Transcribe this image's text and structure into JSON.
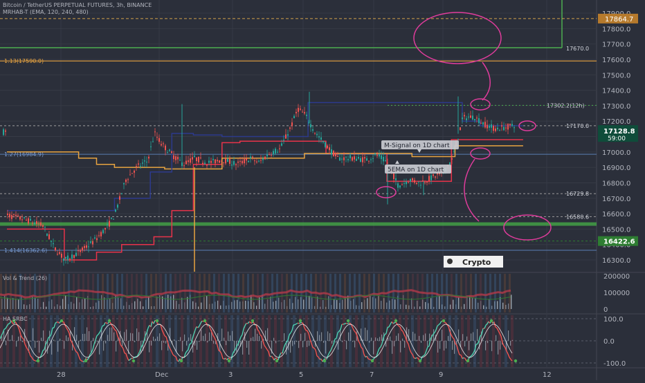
{
  "header": {
    "symbol_line": "Bitcoin / TetherUS PERPETUAL FUTURES, 3h, BINANCE",
    "indicator_line": "MRHAB-T (EMA, 120, 240, 480)"
  },
  "price_axis": {
    "ticks": [
      "17900.0",
      "17800.0",
      "17700.0",
      "17600.0",
      "17500.0",
      "17400.0",
      "17300.0",
      "17200.0",
      "17100.0",
      "17000.0",
      "16900.0",
      "16800.0",
      "16700.0",
      "16600.0",
      "16500.0",
      "16400.0",
      "16300.0"
    ],
    "highlight_top": "17864.7",
    "last_price": "17128.8",
    "countdown": "59:00",
    "highlight_bottom": "16422.6"
  },
  "levels": {
    "l17670": "17670.0",
    "fib113": "1.13(17590.0)",
    "l17302": "17302.2(12h)",
    "l17170": "17170.0",
    "fib127": "1.27(16984.9)",
    "l16729": "16729.8",
    "l16580": "16580.6",
    "fib1414": "1.414(16362.6)"
  },
  "annotations": {
    "msignal": "M-Signal on 1D chart",
    "ema5": "5EMA on 1D chart",
    "logo": "Crypto"
  },
  "vol_panel": {
    "title": "Vol & Trend (26)",
    "ticks": [
      "200000",
      "100000",
      "0"
    ]
  },
  "ha_panel": {
    "title": "HA SRBC",
    "ticks": [
      "100.0",
      "0.0",
      "-100.0"
    ]
  },
  "time_axis": {
    "labels": [
      "28",
      "Dec",
      "3",
      "5",
      "7",
      "9",
      "12"
    ]
  },
  "colors": {
    "bg": "#2b2f3a",
    "up": "#26a69a",
    "down": "#ef5350",
    "orange": "#e8a440",
    "magenta": "#e03c9c",
    "green_line": "#4caf50",
    "navy": "#2d3a8c",
    "red_line": "#e8334a"
  },
  "chart_data": {
    "type": "candlestick",
    "y_range": [
      16240,
      17960
    ],
    "x_labels": [
      "28",
      "Dec",
      "3",
      "5",
      "7",
      "9",
      "12"
    ],
    "close_path": [
      [
        0,
        16590
      ],
      [
        0.5,
        16560
      ],
      [
        1,
        16520
      ],
      [
        1.3,
        16380
      ],
      [
        1.6,
        16300
      ],
      [
        2,
        16350
      ],
      [
        2.4,
        16420
      ],
      [
        2.8,
        16520
      ],
      [
        3,
        16600
      ],
      [
        3.3,
        16820
      ],
      [
        3.6,
        16900
      ],
      [
        3.9,
        16940
      ],
      [
        4.1,
        17120
      ],
      [
        4.3,
        17050
      ],
      [
        4.6,
        16980
      ],
      [
        4.9,
        16920
      ],
      [
        5.2,
        16960
      ],
      [
        5.6,
        16930
      ],
      [
        6,
        16950
      ],
      [
        6.4,
        16920
      ],
      [
        6.8,
        16960
      ],
      [
        7,
        16930
      ],
      [
        7.3,
        16990
      ],
      [
        7.6,
        17020
      ],
      [
        7.9,
        17160
      ],
      [
        8.1,
        17280
      ],
      [
        8.3,
        17240
      ],
      [
        8.6,
        17120
      ],
      [
        8.9,
        17040
      ],
      [
        9.2,
        16960
      ],
      [
        9.6,
        16960
      ],
      [
        10,
        16950
      ],
      [
        10.3,
        16980
      ],
      [
        10.6,
        16930
      ],
      [
        10.9,
        16780
      ],
      [
        11.2,
        16820
      ],
      [
        11.5,
        16800
      ],
      [
        11.8,
        16830
      ],
      [
        12.1,
        16860
      ],
      [
        12.4,
        16950
      ],
      [
        12.7,
        17220
      ],
      [
        13,
        17230
      ],
      [
        13.3,
        17180
      ],
      [
        13.6,
        17150
      ],
      [
        13.9,
        17160
      ],
      [
        14.2,
        17180
      ],
      [
        14.4,
        17130
      ]
    ],
    "volume_max": 200000,
    "oscillator_range": [
      -100,
      100
    ]
  }
}
